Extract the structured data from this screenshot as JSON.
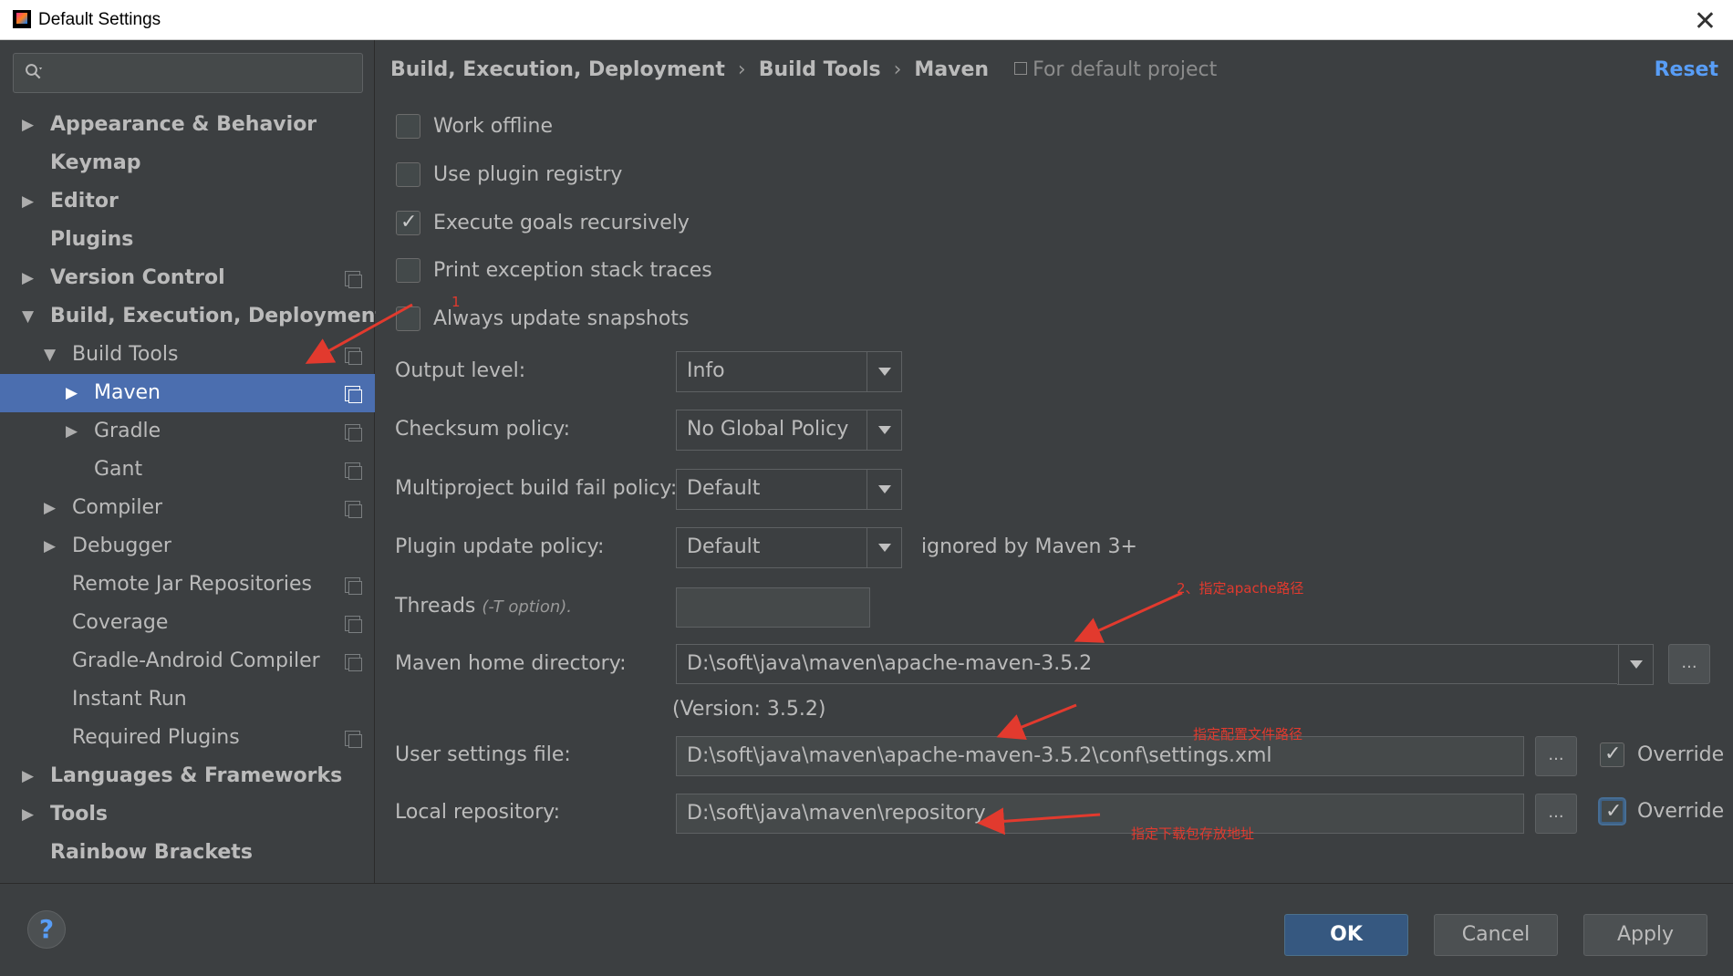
{
  "window": {
    "title": "Default Settings",
    "close_glyph": "✕"
  },
  "search": {
    "placeholder": ""
  },
  "tree": [
    {
      "label": "Appearance & Behavior",
      "level": 0,
      "arrow": "right",
      "bold": true,
      "project_icon": false,
      "selected": false
    },
    {
      "label": "Keymap",
      "level": 0,
      "arrow": "none",
      "bold": true,
      "project_icon": false,
      "selected": false
    },
    {
      "label": "Editor",
      "level": 0,
      "arrow": "right",
      "bold": true,
      "project_icon": false,
      "selected": false
    },
    {
      "label": "Plugins",
      "level": 0,
      "arrow": "none",
      "bold": true,
      "project_icon": false,
      "selected": false
    },
    {
      "label": "Version Control",
      "level": 0,
      "arrow": "right",
      "bold": true,
      "project_icon": true,
      "selected": false
    },
    {
      "label": "Build, Execution, Deployment",
      "level": 0,
      "arrow": "down",
      "bold": true,
      "project_icon": false,
      "selected": false
    },
    {
      "label": "Build Tools",
      "level": 1,
      "arrow": "down",
      "bold": false,
      "project_icon": true,
      "selected": false
    },
    {
      "label": "Maven",
      "level": 2,
      "arrow": "right",
      "bold": false,
      "project_icon": true,
      "selected": true
    },
    {
      "label": "Gradle",
      "level": 2,
      "arrow": "right",
      "bold": false,
      "project_icon": true,
      "selected": false
    },
    {
      "label": "Gant",
      "level": 2,
      "arrow": "none",
      "bold": false,
      "project_icon": true,
      "selected": false
    },
    {
      "label": "Compiler",
      "level": 1,
      "arrow": "right",
      "bold": false,
      "project_icon": true,
      "selected": false
    },
    {
      "label": "Debugger",
      "level": 1,
      "arrow": "right",
      "bold": false,
      "project_icon": false,
      "selected": false
    },
    {
      "label": "Remote Jar Repositories",
      "level": 1,
      "arrow": "none",
      "bold": false,
      "project_icon": true,
      "selected": false
    },
    {
      "label": "Coverage",
      "level": 1,
      "arrow": "none",
      "bold": false,
      "project_icon": true,
      "selected": false
    },
    {
      "label": "Gradle-Android Compiler",
      "level": 1,
      "arrow": "none",
      "bold": false,
      "project_icon": true,
      "selected": false
    },
    {
      "label": "Instant Run",
      "level": 1,
      "arrow": "none",
      "bold": false,
      "project_icon": false,
      "selected": false
    },
    {
      "label": "Required Plugins",
      "level": 1,
      "arrow": "none",
      "bold": false,
      "project_icon": true,
      "selected": false
    },
    {
      "label": "Languages & Frameworks",
      "level": 0,
      "arrow": "right",
      "bold": true,
      "project_icon": false,
      "selected": false
    },
    {
      "label": "Tools",
      "level": 0,
      "arrow": "right",
      "bold": true,
      "project_icon": false,
      "selected": false
    },
    {
      "label": "Rainbow Brackets",
      "level": 0,
      "arrow": "none",
      "bold": true,
      "project_icon": false,
      "selected": false
    }
  ],
  "breadcrumb": {
    "items": [
      "Build, Execution, Deployment",
      "Build Tools",
      "Maven"
    ],
    "separator": "›",
    "scope": "For default project"
  },
  "reset_label": "Reset",
  "checkboxes": [
    {
      "label": "Work offline",
      "checked": false
    },
    {
      "label": "Use plugin registry",
      "checked": false
    },
    {
      "label": "Execute goals recursively",
      "checked": true
    },
    {
      "label": "Print exception stack traces",
      "checked": false
    },
    {
      "label": "Always update snapshots",
      "checked": false
    }
  ],
  "form": {
    "output_level": {
      "label": "Output level:",
      "value": "Info"
    },
    "checksum_policy": {
      "label": "Checksum policy:",
      "value": "No Global Policy"
    },
    "multiproject": {
      "label": "Multiproject build fail policy:",
      "value": "Default"
    },
    "plugin_update": {
      "label": "Plugin update policy:",
      "value": "Default",
      "note": "ignored by Maven 3+"
    },
    "threads": {
      "label": "Threads",
      "hint": "(-T option).",
      "value": ""
    },
    "maven_home": {
      "label": "Maven home directory:",
      "value": "D:\\soft\\java\\maven\\apache-maven-3.5.2",
      "version": "(Version: 3.5.2)"
    },
    "user_settings": {
      "label": "User settings file:",
      "value": "D:\\soft\\java\\maven\\apache-maven-3.5.2\\conf\\settings.xml",
      "override_label": "Override",
      "override": true
    },
    "local_repo": {
      "label": "Local repository:",
      "value": "D:\\soft\\java\\maven\\repository",
      "override_label": "Override",
      "override": true
    },
    "browse_label": "..."
  },
  "annotations": {
    "a1": "1",
    "a2": "2、指定apache路径",
    "a3": "指定配置文件路径",
    "a4": "指定下载包存放地址",
    "color": "#e23a2e"
  },
  "buttons": {
    "help": "?",
    "ok": "OK",
    "cancel": "Cancel",
    "apply": "Apply"
  }
}
